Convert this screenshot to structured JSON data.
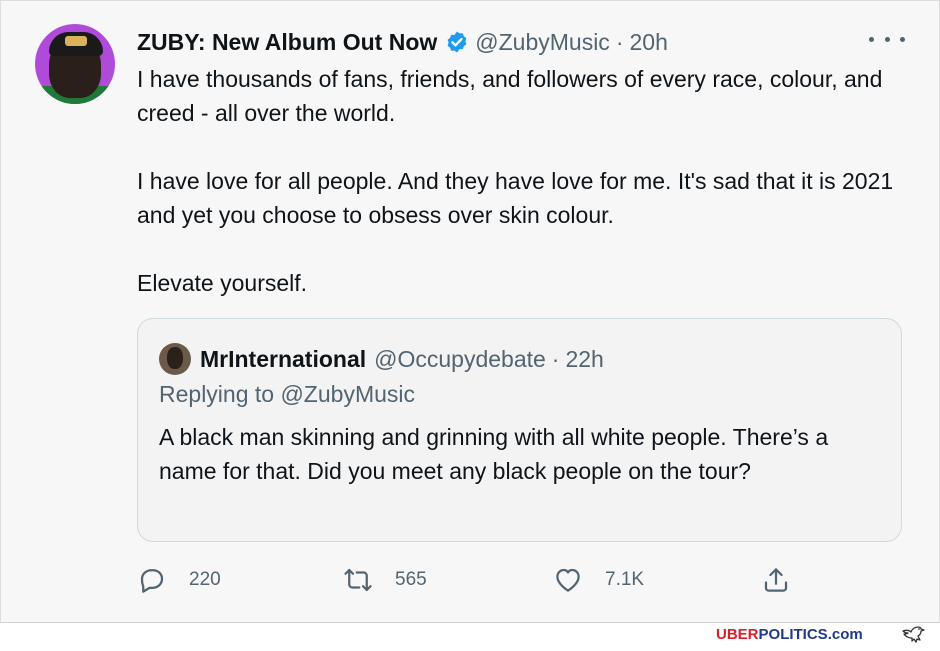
{
  "tweet": {
    "author_name": "ZUBY: New Album Out Now",
    "handle": "@ZubyMusic",
    "separator": "·",
    "time": "20h",
    "paragraphs": [
      "I have thousands of fans, friends, and followers of every race, colour, and creed - all over the world.",
      "I have love for all people. And they have love for me. It's sad that it is 2021 and yet you choose to obsess over skin colour.",
      "Elevate yourself."
    ]
  },
  "quote": {
    "author_name": "MrInternational",
    "handle": "@Occupydebate",
    "separator": "·",
    "time": "22h",
    "replying_to": "Replying to @ZubyMusic",
    "text": "A black man skinning and grinning with all white people. There’s a name for that.  Did you meet any black people on the tour?"
  },
  "actions": {
    "reply_count": "220",
    "retweet_count": "565",
    "like_count": "7.1K"
  },
  "watermark": {
    "part1": "UBER",
    "part2": "POLITICS",
    "part3": ".com"
  },
  "icons": [
    "verified-badge-icon",
    "more-icon",
    "reply-icon",
    "retweet-icon",
    "like-icon",
    "share-icon",
    "eagle-logo-icon"
  ],
  "colors": {
    "verified": "#1d9bf0",
    "secondary_text": "#536471",
    "watermark_red": "#d6202a",
    "watermark_blue": "#1e3a8a"
  }
}
